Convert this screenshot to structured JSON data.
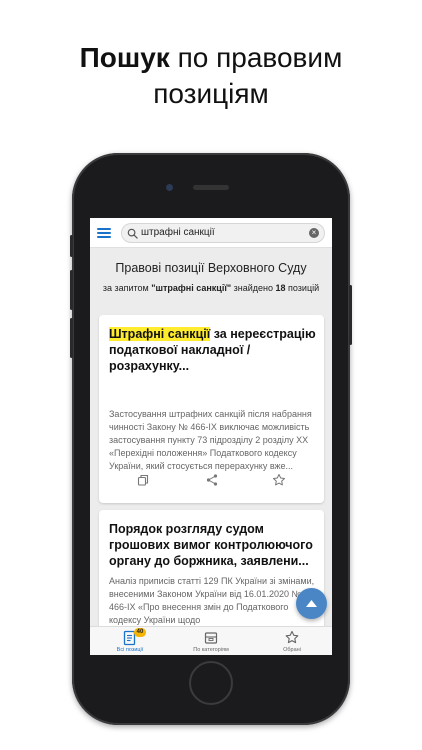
{
  "promo": {
    "title_bold": "Пошук",
    "title_rest": " по правовим",
    "title_line2": "позиціям"
  },
  "search": {
    "query": "штрафні санкції",
    "clear_symbol": "×"
  },
  "results": {
    "heading": "Правові позиції Верховного Суду",
    "prefix": "за запитом ",
    "query_quoted": "\"штрафні санкції\"",
    "found_label": " знайдено ",
    "count": "18",
    "suffix": " позицій"
  },
  "cards": [
    {
      "title_highlight": "Штрафні санкції",
      "title_rest": " за нереєстрацію податкової накладної / розрахунку...",
      "body": "Застосування штрафних санкцій після набрання чинності Закону № 466-IX виключає можливість застосування пункту 73 підрозділу 2 розділу XX «Перехідні положення» Податкового кодексу України, який стосується перерахунку вже..."
    },
    {
      "title": "Порядок розгляду судом грошових вимог контролюючого органу до боржника, заявлени...",
      "body": "Аналіз приписів статті 129 ПК України зі змінами, внесеними Законом України від 16.01.2020 № 466-IX «Про внесення змін до Податкового кодексу України щодо"
    }
  ],
  "bottom_nav": {
    "items": [
      {
        "label": "Всі позиції",
        "badge": "40"
      },
      {
        "label": "По категоріям"
      },
      {
        "label": "Обрані"
      }
    ]
  },
  "colors": {
    "accent": "#1a73c8",
    "highlight": "#ffec2e",
    "badge": "#f5b400",
    "fab": "#4a86c6"
  }
}
